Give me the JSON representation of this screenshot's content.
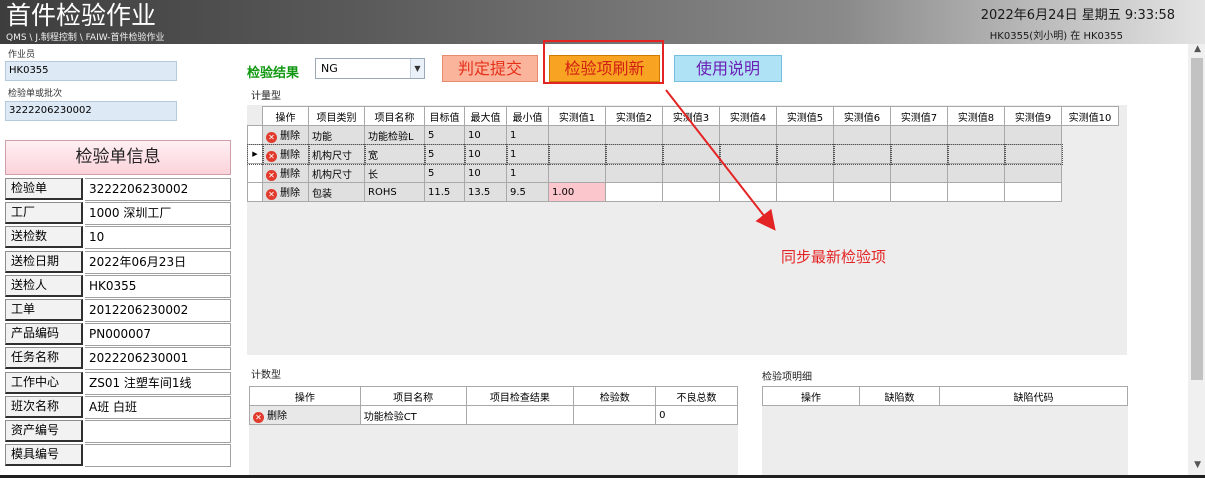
{
  "header": {
    "app_title": "首件检验作业",
    "breadcrumb": "QMS \\ J.制程控制 \\ FAIW-首件检验作业",
    "datetime": "2022年6月24日 星期五 9:33:58",
    "user_info": "HK0355(刘小明) 在 HK0355"
  },
  "left": {
    "operator_label": "作业员",
    "operator_value": "HK0355",
    "order_label": "检验单或批次",
    "order_value": "3222206230002",
    "info_title": "检验单信息",
    "info_rows": [
      {
        "key": "检验单",
        "value": "3222206230002"
      },
      {
        "key": "工厂",
        "value": "1000 深圳工厂"
      },
      {
        "key": "送检数",
        "value": "10"
      },
      {
        "key": "送检日期",
        "value": "2022年06月23日"
      },
      {
        "key": "送检人",
        "value": "HK0355"
      },
      {
        "key": "工单",
        "value": "2012206230002"
      },
      {
        "key": "产品编码",
        "value": "PN000007"
      },
      {
        "key": "任务名称",
        "value": "2022206230001"
      },
      {
        "key": "工作中心",
        "value": "ZS01 注塑车间1线"
      },
      {
        "key": "班次名称",
        "value": "A班 白班"
      },
      {
        "key": "资产编号",
        "value": ""
      },
      {
        "key": "模具编号",
        "value": ""
      }
    ]
  },
  "toolbar": {
    "result_label": "检验结果",
    "result_value": "NG",
    "submit_label": "判定提交",
    "refresh_label": "检验项刷新",
    "help_label": "使用说明"
  },
  "measure": {
    "section_label": "计量型",
    "columns": [
      "操作",
      "项目类别",
      "项目名称",
      "目标值",
      "最大值",
      "最小值",
      "实测值1",
      "实测值2",
      "实测值3",
      "实测值4",
      "实测值5",
      "实测值6",
      "实测值7",
      "实测值8",
      "实测值9",
      "实测值10"
    ],
    "delete_label": "删除",
    "rows": [
      {
        "category": "功能",
        "name": "功能检验L",
        "target": "5",
        "max": "10",
        "min": "1",
        "m1": ""
      },
      {
        "category": "机构尺寸",
        "name": "宽",
        "target": "5",
        "max": "10",
        "min": "1",
        "m1": ""
      },
      {
        "category": "机构尺寸",
        "name": "长",
        "target": "5",
        "max": "10",
        "min": "1",
        "m1": ""
      },
      {
        "category": "包装",
        "name": "ROHS",
        "target": "11.5",
        "max": "13.5",
        "min": "9.5",
        "m1": "1.00"
      }
    ]
  },
  "count": {
    "section_label": "计数型",
    "columns": [
      "操作",
      "项目名称",
      "项目检查结果",
      "检验数",
      "不良总数"
    ],
    "delete_label": "删除",
    "rows": [
      {
        "name": "功能检验CT",
        "result": "",
        "inspected": "",
        "defects": "0"
      }
    ]
  },
  "detail": {
    "section_label": "检验项明细",
    "columns": [
      "操作",
      "缺陷数",
      "缺陷代码"
    ]
  },
  "annotation": {
    "text": "同步最新检验项",
    "color": "#e42424"
  }
}
